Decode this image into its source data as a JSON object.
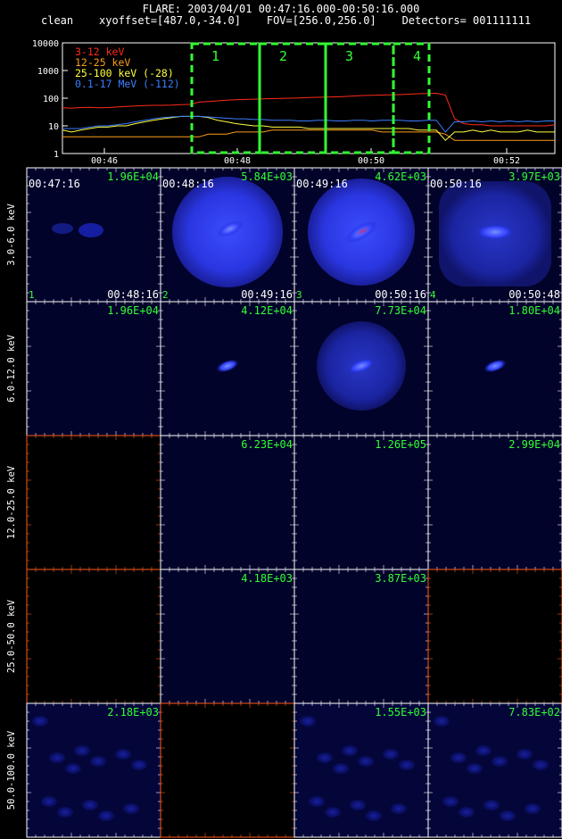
{
  "header": {
    "title": "FLARE: 2003/04/01 00:47:16.000-00:50:16.000",
    "params": "clean    xyoffset=[487.0,-34.0]    FOV=[256.0,256.0]    Detectors= 001111111"
  },
  "chart_data": [
    {
      "type": "line",
      "yscale": "log",
      "ylim": [
        1,
        10000
      ],
      "y_ticks": [
        "10000",
        "1000",
        "100",
        "10",
        "1"
      ],
      "x_ticks": [
        "00:46",
        "00:48",
        "00:50",
        "00:52"
      ],
      "legend_position": "top-left",
      "series": [
        {
          "name": "3-12 keV",
          "color": "#ff2a1a",
          "values": [
            45,
            44,
            46,
            47,
            45,
            46,
            48,
            50,
            52,
            54,
            55,
            55,
            56,
            58,
            60,
            72,
            76,
            80,
            84,
            88,
            90,
            92,
            94,
            96,
            98,
            100,
            102,
            105,
            108,
            110,
            112,
            115,
            120,
            125,
            128,
            130,
            132,
            135,
            140,
            145,
            148,
            150,
            130,
            18,
            12,
            11,
            11,
            10,
            10,
            10,
            10,
            10,
            10,
            10,
            11
          ]
        },
        {
          "name": "12-25 keV",
          "color": "#ff9a1a",
          "values": [
            4,
            4,
            4,
            4,
            4,
            4,
            4,
            4,
            4,
            4,
            4,
            4,
            4,
            4,
            4,
            4,
            5,
            5,
            5,
            6,
            6,
            6,
            6,
            7,
            7,
            7,
            7,
            7,
            7,
            7,
            7,
            7,
            7,
            7,
            7,
            6,
            6,
            6,
            6,
            6,
            6,
            6,
            5,
            3,
            3,
            3,
            3,
            3,
            3,
            3,
            3,
            3,
            3,
            3,
            3
          ]
        },
        {
          "name": "25-100 keV (-28)",
          "color": "#ffff40",
          "values": [
            7,
            6,
            7,
            8,
            9,
            9,
            10,
            10,
            12,
            14,
            16,
            18,
            20,
            22,
            22,
            22,
            20,
            16,
            14,
            12,
            11,
            10,
            10,
            9,
            9,
            9,
            9,
            8,
            8,
            8,
            8,
            8,
            8,
            8,
            8,
            8,
            8,
            8,
            8,
            7,
            7,
            7,
            3,
            6,
            6,
            7,
            6,
            7,
            6,
            6,
            6,
            7,
            6,
            6,
            6
          ]
        },
        {
          "name": "0.1-17 MeV (-112)",
          "color": "#3c7dff",
          "values": [
            8,
            8,
            8,
            9,
            10,
            10,
            11,
            12,
            14,
            16,
            18,
            20,
            21,
            22,
            22,
            22,
            21,
            20,
            19,
            18,
            18,
            17,
            17,
            16,
            16,
            16,
            15,
            15,
            16,
            16,
            15,
            15,
            16,
            16,
            15,
            16,
            16,
            16,
            15,
            15,
            16,
            16,
            6,
            14,
            14,
            15,
            14,
            15,
            14,
            15,
            14,
            15,
            14,
            15,
            15
          ]
        }
      ],
      "intervals": [
        "1",
        "2",
        "3",
        "4"
      ]
    },
    {
      "type": "heatmap",
      "rows": [
        "3.0-6.0 keV",
        "6.0-12.0 keV",
        "12.0-25.0 keV",
        "25.0-50.0 keV",
        "50.0-100.0 keV"
      ],
      "columns": [
        {
          "start": "00:47:16",
          "end": "00:48:16",
          "index": "1"
        },
        {
          "start": "00:48:16",
          "end": "00:49:16",
          "index": "2"
        },
        {
          "start": "00:49:16",
          "end": "00:50:16",
          "index": "3"
        },
        {
          "start": "00:50:16",
          "end": "00:50:48",
          "index": "4"
        }
      ],
      "max_values": [
        [
          "1.96E+04",
          "5.84E+03",
          "4.62E+03",
          "3.97E+03"
        ],
        [
          "1.96E+04",
          "4.12E+04",
          "7.73E+04",
          "1.80E+04"
        ],
        [
          "",
          "6.23E+04",
          "1.26E+05",
          "2.99E+04"
        ],
        [
          "",
          "4.18E+03",
          "3.87E+03",
          ""
        ],
        [
          "2.18E+03",
          "",
          "1.55E+03",
          "7.83E+02"
        ]
      ]
    }
  ]
}
